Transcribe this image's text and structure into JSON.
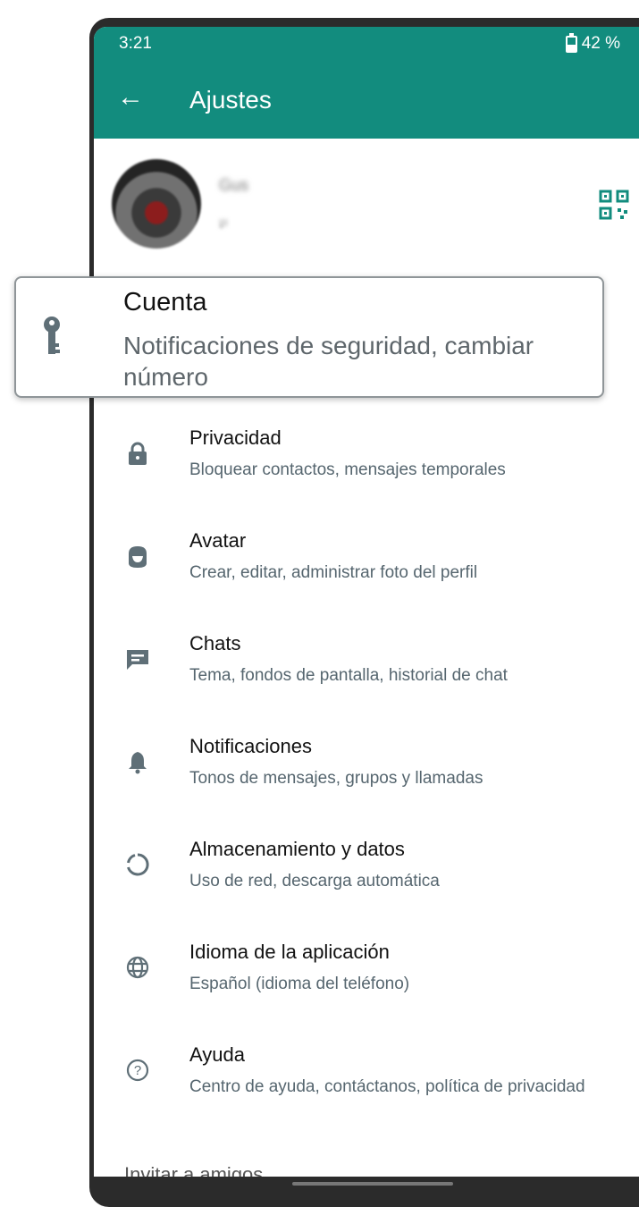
{
  "status_bar": {
    "time": "3:21",
    "battery": "42 %"
  },
  "app_bar": {
    "title": "Ajustes"
  },
  "profile": {
    "name": "Gus",
    "status": "·"
  },
  "highlighted": {
    "label": "Cuenta",
    "subtitle": "Notificaciones de seguridad, cambiar número"
  },
  "settings": [
    {
      "label": "Privacidad",
      "subtitle": "Bloquear contactos, mensajes temporales",
      "icon": "lock-icon"
    },
    {
      "label": "Avatar",
      "subtitle": "Crear, editar, administrar foto del perfil",
      "icon": "avatar-icon"
    },
    {
      "label": "Chats",
      "subtitle": "Tema, fondos de pantalla, historial de chat",
      "icon": "chat-icon"
    },
    {
      "label": "Notificaciones",
      "subtitle": "Tonos de mensajes, grupos y llamadas",
      "icon": "bell-icon"
    },
    {
      "label": "Almacenamiento y datos",
      "subtitle": "Uso de red, descarga automática",
      "icon": "storage-icon"
    },
    {
      "label": "Idioma de la aplicación",
      "subtitle": "Español (idioma del teléfono)",
      "icon": "globe-icon"
    },
    {
      "label": "Ayuda",
      "subtitle": "Centro de ayuda, contáctanos, política de privacidad",
      "icon": "help-icon"
    }
  ],
  "next_item_partial": "Invitar a amigos",
  "colors": {
    "header": "#128c7e",
    "icon": "#5f6f77",
    "qr": "#128c7e"
  }
}
